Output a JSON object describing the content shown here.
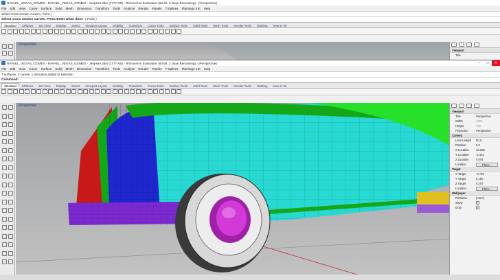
{
  "colors": {
    "teal": "#27d9d2",
    "blue": "#1f27cf",
    "red": "#c81818",
    "green": "#14a818",
    "lime": "#27e02a",
    "purple": "#7c2ad0",
    "magenta": "#d13ad6",
    "tire": "#3a3a3a",
    "accent": "#e81123"
  },
  "back_window": {
    "title": "RAFAEL_VEGAS_GOMES - RAFAEL_VEGAS_GOMES - Jeepster.3dm (1777 KB) - Rhinoceros Evaluation (64-bit, 3 Days Remaining) - [Perspective]",
    "menu": [
      "File",
      "Edit",
      "View",
      "Curve",
      "Surface",
      "Solid",
      "Mesh",
      "Dimension",
      "Transform",
      "Tools",
      "Analyze",
      "Render",
      "Panels",
      "T-Splines",
      "Flamingo nXt",
      "Help"
    ],
    "history": "Select cross section curves ( Point )",
    "prompt": "Select cross section curves. Press Enter when done",
    "prompt_option": "( Point )",
    "tabs": [
      "Standard",
      "CPlanes",
      "Set View",
      "Display",
      "Select",
      "Viewport Layout",
      "Visibility",
      "Transform",
      "Curve Tools",
      "Surface Tools",
      "Solid Tools",
      "Mesh Tools",
      "Render Tools",
      "Drafting",
      "New in V5"
    ],
    "viewport_label": "Perspective",
    "props_label": "Viewport",
    "props_title": "Title"
  },
  "front_window": {
    "title": "RAFAEL_VEGAS_GOMES - RAFAEL_VEGAS_GOMES - Jeepster.3dm (1777 KB) - Rhinoceros Evaluation (64-bit, 3 Days Remaining) - [Perspective]",
    "menu": [
      "File",
      "Edit",
      "View",
      "Curve",
      "Surface",
      "Solid",
      "Mesh",
      "Dimension",
      "Transform",
      "Tools",
      "Analyze",
      "Render",
      "Panels",
      "T-Splines",
      "Flamingo nXt",
      "Help"
    ],
    "history": "7 surfaces, 3 curves, 1 extrusion added to selection.",
    "prompt_label": "Command:",
    "tabs": [
      "Standard",
      "CPlanes",
      "Set View",
      "Display",
      "Select",
      "Viewport Layout",
      "Visibility",
      "Transform",
      "Curve Tools",
      "Surface Tools",
      "Solid Tools",
      "Mesh Tools",
      "Render Tools",
      "Drafting",
      "New in V5"
    ],
    "viewport_label": "Perspective",
    "properties": {
      "viewport_section": "Viewport",
      "title_label": "Title",
      "title_value": "Perspective",
      "width_label": "Width",
      "width_value": "1584",
      "height_label": "Height",
      "height_value": "798",
      "projection_label": "Projection",
      "projection_value": "Perspective",
      "camera_section": "Camera",
      "lens_label": "Lens Length",
      "lens_value": "50.0",
      "rotation_label": "Rotation",
      "rotation_value": "0.0",
      "xloc_label": "X Location",
      "xloc_value": "18.256",
      "yloc_label": "Y Location",
      "yloc_value": "-2.442",
      "zloc_label": "Z Location",
      "zloc_value": "0.544",
      "location_label": "Location",
      "place_label": "Place...",
      "target_section": "Target",
      "xt_label": "X Target",
      "xt_value": "-0.749",
      "yt_label": "Y Target",
      "yt_value": "0.150",
      "zt_label": "Z Target",
      "zt_value": "0.207",
      "tloc_label": "Location",
      "tplace_label": "Place...",
      "wallpaper_section": "Wallpaper",
      "filename_label": "Filename",
      "filename_value": "(none)",
      "show_label": "Show",
      "gray_label": "Gray"
    }
  }
}
